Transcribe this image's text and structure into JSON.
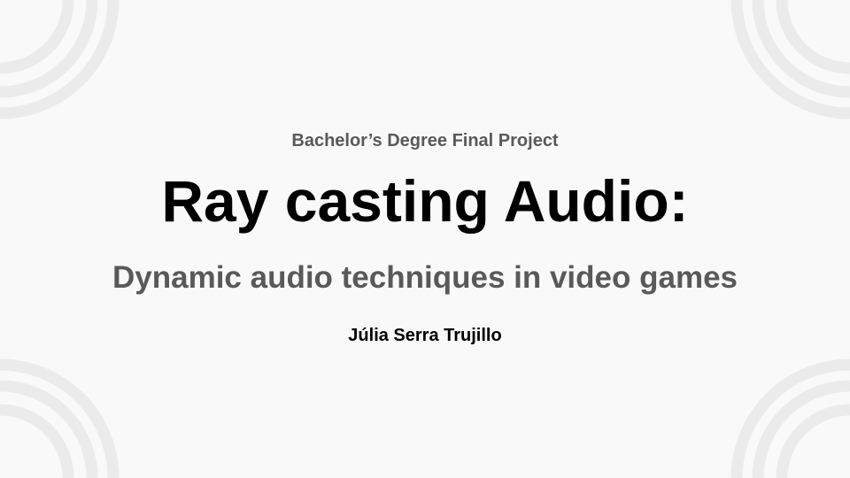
{
  "slide": {
    "supertitle": "Bachelor’s Degree Final Project",
    "title": "Ray casting Audio:",
    "subtitle": "Dynamic audio techniques in video games",
    "author": "Júlia Serra Trujillo"
  },
  "colors": {
    "background": "#f9f9f9",
    "rings": "#ebebeb",
    "gray_text": "#595959"
  }
}
